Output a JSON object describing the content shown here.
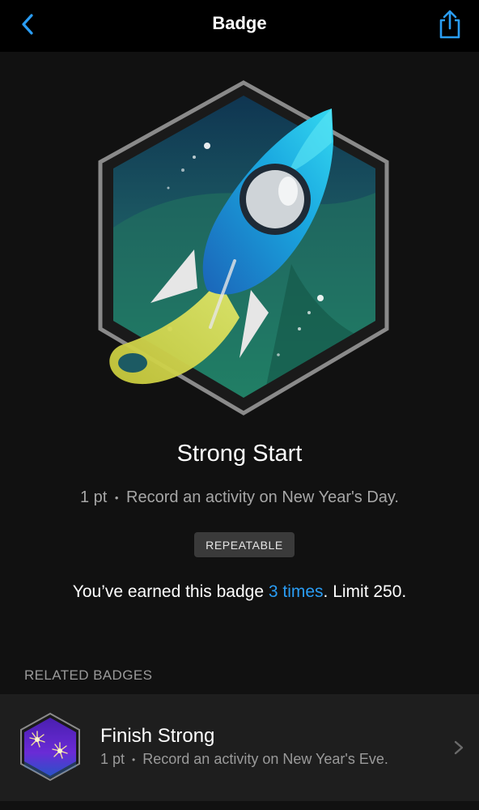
{
  "nav": {
    "title": "Badge",
    "back_icon": "chevron-left-icon",
    "share_icon": "share-icon"
  },
  "badge": {
    "name": "Strong Start",
    "points": "1 pt",
    "separator": "•",
    "description": "Record an activity on New Year's Day.",
    "tag": "REPEATABLE",
    "earned_prefix": "You’ve earned this badge ",
    "earned_link": "3 times",
    "earned_suffix": ". Limit 250.",
    "art_icon": "rocket-hexagon-badge-icon"
  },
  "related": {
    "header": "RELATED BADGES",
    "items": [
      {
        "name": "Finish Strong",
        "points": "1 pt",
        "separator": "•",
        "description": "Record an activity on New Year's Eve.",
        "icon": "fireworks-hexagon-badge-icon"
      }
    ]
  },
  "colors": {
    "accent": "#2a9df4",
    "background": "#111111",
    "navbar": "#000000",
    "row": "#1e1e1e",
    "secondary_text": "#a7a7a7"
  }
}
